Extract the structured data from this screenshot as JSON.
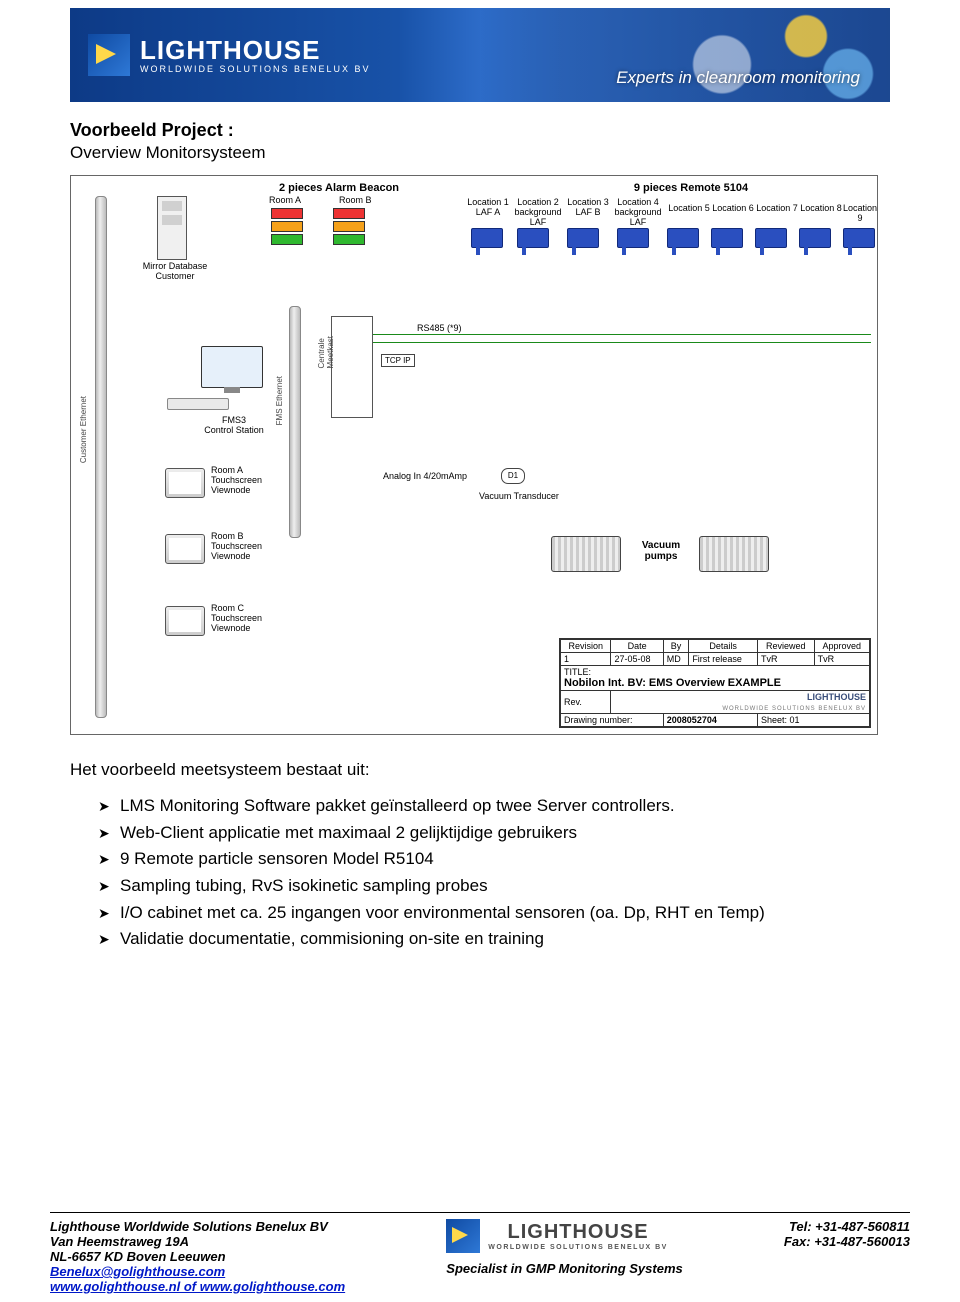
{
  "header": {
    "brand_main": "LIGHTHOUSE",
    "brand_sub": "WORLDWIDE SOLUTIONS BENELUX BV",
    "tagline": "Experts in cleanroom monitoring"
  },
  "title": "Voorbeeld Project :",
  "subtitle": "Overview Monitorsysteem",
  "diagram": {
    "alarm_beacon": "2 pieces Alarm Beacon",
    "room_a": "Room A",
    "room_b": "Room B",
    "remote_5104": "9 pieces Remote 5104",
    "locations": [
      "Location 1\nLAF A",
      "Location 2\nbackground LAF",
      "Location 3\nLAF B",
      "Location 4\nbackground LAF",
      "Location 5",
      "Location 6",
      "Location 7",
      "Location 8",
      "Location 9"
    ],
    "mirror_db": "Mirror Database\nCustomer",
    "customer_ethernet": "Customer Ethernet",
    "fms_ethernet": "FMS Ethernet",
    "centrale_meetkast": "Centrale\nMeetkast",
    "rs485": "RS485 (*9)",
    "tcp_ip": "TCP IP",
    "fms3": "FMS3\nControl Station",
    "analog_in": "Analog In 4/20mAmp",
    "vacuum_transducer": "Vacuum Transducer",
    "vacuum_pumps": "Vacuum\npumps",
    "viewnodes": [
      "Room A\nTouchscreen\nViewnode",
      "Room B\nTouchscreen\nViewnode",
      "Room C\nTouchscreen\nViewnode"
    ],
    "d1": "D1",
    "titleblock": {
      "rev_hdr": [
        "Revision",
        "Date",
        "By",
        "Details",
        "Reviewed",
        "Approved"
      ],
      "rev_row": [
        "1",
        "27-05-08",
        "MD",
        "First release",
        "TvR",
        "TvR"
      ],
      "title_label": "TITLE:",
      "title_value": "Nobilon Int. BV: EMS Overview EXAMPLE",
      "rev_label": "Rev.",
      "logo_main": "LIGHTHOUSE",
      "logo_sub": "WORLDWIDE SOLUTIONS BENELUX BV",
      "drawing_label": "Drawing number:",
      "drawing_value": "2008052704",
      "sheet_label": "Sheet: 01"
    }
  },
  "body_intro": "Het voorbeeld meetsysteem bestaat uit:",
  "bullets": [
    "LMS Monitoring Software pakket geïnstalleerd op twee Server controllers.",
    "Web-Client applicatie met maximaal 2 gelijktijdige gebruikers",
    "9 Remote particle sensoren Model R5104",
    "Sampling tubing, RvS isokinetic sampling probes",
    "I/O cabinet met ca. 25 ingangen voor environmental sensoren (oa. Dp, RHT en Temp)",
    "Validatie documentatie, commisioning on-site en training"
  ],
  "footer": {
    "company": "Lighthouse Worldwide Solutions Benelux BV",
    "addr1": "Van Heemstraweg 19A",
    "addr2": "NL-6657 KD Boven Leeuwen",
    "email": "Benelux@golighthouse.com",
    "web": "www.golighthouse.nl of www.golighthouse.com",
    "logo_main": "LIGHTHOUSE",
    "logo_sub": "WORLDWIDE SOLUTIONS BENELUX BV",
    "specialist": "Specialist in GMP Monitoring Systems",
    "tel": "Tel: +31-487-560811",
    "fax": "Fax: +31-487-560013"
  }
}
